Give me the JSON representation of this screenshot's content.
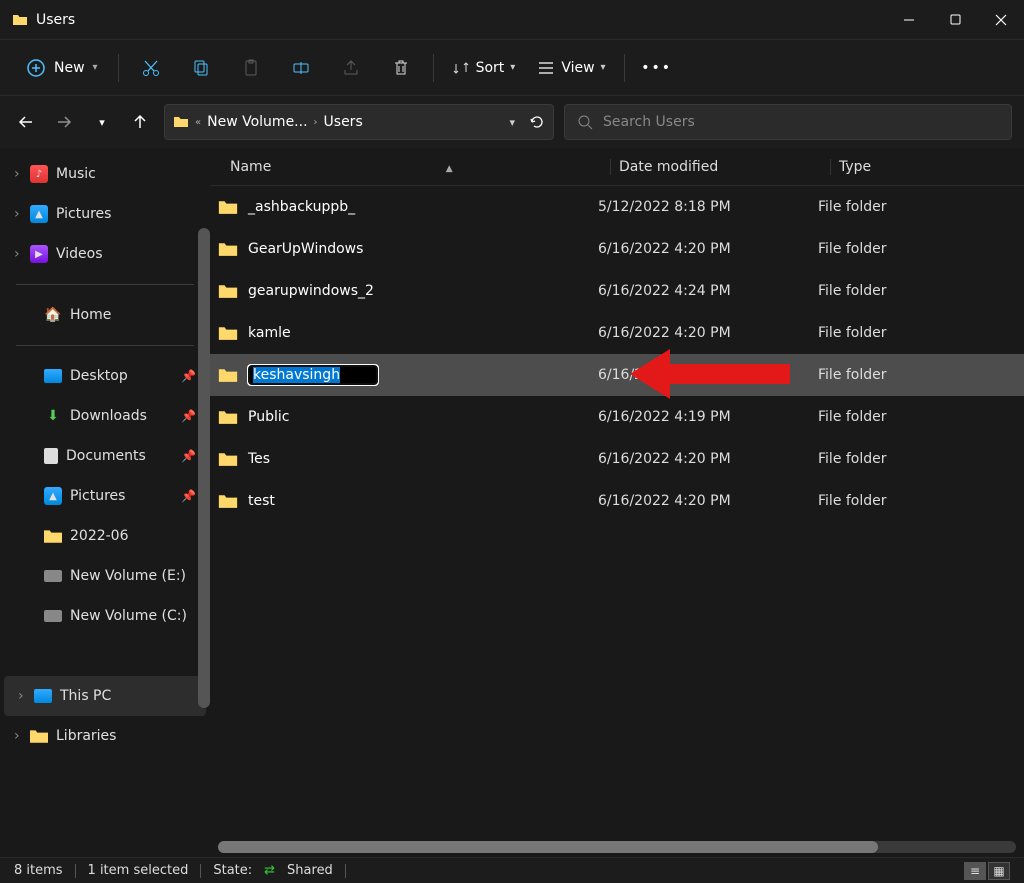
{
  "window": {
    "title": "Users"
  },
  "toolbar": {
    "new_label": "New",
    "sort_label": "Sort",
    "view_label": "View"
  },
  "breadcrumb": {
    "item1": "New Volume...",
    "item2": "Users"
  },
  "search": {
    "placeholder": "Search Users"
  },
  "sidebar": {
    "music": "Music",
    "pictures_lib": "Pictures",
    "videos": "Videos",
    "home": "Home",
    "desktop": "Desktop",
    "downloads": "Downloads",
    "documents": "Documents",
    "pictures": "Pictures",
    "folder_2022_06": "2022-06",
    "volume_e": "New Volume (E:)",
    "volume_c": "New Volume (C:)",
    "this_pc": "This PC",
    "libraries": "Libraries"
  },
  "columns": {
    "name": "Name",
    "date": "Date modified",
    "type": "Type"
  },
  "rows": [
    {
      "name": "_ashbackuppb_",
      "date": "5/12/2022 8:18 PM",
      "type": "File folder",
      "editing": false
    },
    {
      "name": "GearUpWindows",
      "date": "6/16/2022 4:20 PM",
      "type": "File folder",
      "editing": false
    },
    {
      "name": "gearupwindows_2",
      "date": "6/16/2022 4:24 PM",
      "type": "File folder",
      "editing": false
    },
    {
      "name": "kamle",
      "date": "6/16/2022 4:20 PM",
      "type": "File folder",
      "editing": false
    },
    {
      "name": "keshavsingh",
      "date": "6/16/2022 4:20 PM",
      "type": "File folder",
      "editing": true
    },
    {
      "name": "Public",
      "date": "6/16/2022 4:19 PM",
      "type": "File folder",
      "editing": false
    },
    {
      "name": "Tes",
      "date": "6/16/2022 4:20 PM",
      "type": "File folder",
      "editing": false
    },
    {
      "name": "test",
      "date": "6/16/2022 4:20 PM",
      "type": "File folder",
      "editing": false
    }
  ],
  "status": {
    "items": "8 items",
    "selected": "1 item selected",
    "state_label": "State:",
    "shared": "Shared"
  }
}
